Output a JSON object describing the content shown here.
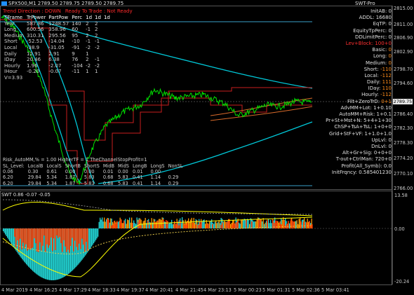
{
  "header": {
    "title": "SPX500,M1  2789.50 2789.75 2789.50 2789.75",
    "indicator": "SWT-Pro"
  },
  "status": {
    "trend_direction": "Trend Direction : DOWN",
    "ready": "Ready To Trade : Not Ready"
  },
  "stats_table": {
    "headers": [
      "TFrame",
      "TrPower",
      "PartPow",
      "Perc",
      "1d",
      "1d",
      "1d"
    ],
    "rows": [
      [
        "Year",
        "587.86",
        "1248.57",
        "140",
        "2",
        "2",
        ""
      ],
      [
        "Long",
        "600.56",
        "358.96",
        "60",
        "-1",
        "2",
        ""
      ],
      [
        "Medium",
        "310.31",
        "295.56",
        "95",
        "2",
        "2",
        ""
      ],
      [
        "Short",
        "-52.53",
        "-14.04",
        "-10",
        "-1",
        "-1",
        ""
      ],
      [
        "Local",
        "-38.9",
        "-31.05",
        "-91",
        "-2",
        "-2",
        ""
      ],
      [
        "Daily",
        "12.91",
        "2.91",
        "9",
        "1",
        "",
        ""
      ],
      [
        "IDay",
        "20.46",
        "6.38",
        "76",
        "2",
        "-1",
        ""
      ],
      [
        "Hourly",
        "1.96",
        "-2.07",
        "-104",
        "-2",
        "-2",
        ""
      ],
      [
        "IHour",
        "-0.20",
        "-0.07",
        "-11",
        "1",
        "1",
        ""
      ],
      [
        "V=3.93",
        "",
        "",
        "",
        "",
        "",
        ""
      ]
    ]
  },
  "risk": {
    "line1": "Risk_AutoMM,% = 1.00   HigherTF = 1     TheChannelStopProfit=1",
    "headers": [
      "SL_Level:",
      "LocalB",
      "LocalS",
      "ShortB",
      "ShortS",
      "MidB",
      "MidS",
      "LongB",
      "LongS",
      "NonSL"
    ],
    "rows": [
      [
        "0.06",
        "0.30",
        "0.61",
        "0.00",
        "0.00",
        "0.01",
        "0.00",
        "0.01",
        "0.00",
        ""
      ],
      [
        "6.20",
        "29.84",
        "5.34",
        "1.87",
        "5.83",
        "0.68",
        "5.83",
        "0.41",
        "1.14",
        "0.29"
      ],
      [
        "6.20",
        "29.84",
        "5.34",
        "1.87",
        "5.83",
        "0.68",
        "5.83",
        "0.41",
        "1.14",
        "0.29"
      ]
    ]
  },
  "panel": [
    {
      "label": "InitAB:",
      "value": "0",
      "c": "w"
    },
    {
      "label": "ADDL:",
      "value": "16680",
      "c": "w"
    },
    {
      "label": "EqTP:",
      "value": "0",
      "c": "w"
    },
    {
      "label": "EquityTpPerc:",
      "value": "0",
      "c": "w"
    },
    {
      "label": "DDLimitPerc:",
      "value": "0",
      "c": "w"
    },
    {
      "label": "Lev+Block:",
      "value": "100+0",
      "c": "r"
    },
    {
      "label": "Basic:",
      "value": "0",
      "c": "o"
    },
    {
      "label": "Long:",
      "value": "0",
      "c": "o"
    },
    {
      "label": "Medium:",
      "value": "0",
      "c": "o"
    },
    {
      "label": "Short:",
      "value": "-110",
      "c": "o"
    },
    {
      "label": "Local:",
      "value": "-112",
      "c": "o"
    },
    {
      "label": "Daily:",
      "value": "111",
      "c": "o"
    },
    {
      "label": "IDay:",
      "value": "110",
      "c": "o"
    },
    {
      "label": "Hourly:",
      "value": "-112",
      "c": "o"
    },
    {
      "label": "Filt+ZeroTrD:",
      "value": "0+1",
      "c": "o"
    },
    {
      "label": "AdvMM+Lot:",
      "value": "1+0.10",
      "c": "w"
    },
    {
      "label": "AutoMM+Risk:",
      "value": "1+0.1",
      "c": "w"
    },
    {
      "label": "Pr+St+Mst+N:",
      "value": "5+4+1+30",
      "c": "w"
    },
    {
      "label": "ChSP+TsA+TsL:",
      "value": "1+0+0",
      "c": "w"
    },
    {
      "label": "Grid+StF+VF:",
      "value": "1+1.0+1.0",
      "c": "w"
    },
    {
      "label": "UpLvl:",
      "value": "0",
      "c": "w"
    },
    {
      "label": "DnLvl:",
      "value": "0",
      "c": "w"
    },
    {
      "label": "Alt+Gr+Sig:",
      "value": "0+0+0",
      "c": "w"
    },
    {
      "label": "T-out+CtrlMan:",
      "value": "720+0",
      "c": "w"
    },
    {
      "label": "Profit(All_Symb):",
      "value": "0.0",
      "c": "w"
    },
    {
      "label": "InitFrqncy:",
      "value": "0.585401230",
      "c": "w"
    }
  ],
  "price_axis": [
    "2815.00",
    "2811.00",
    "2806.90",
    "2802.90",
    "2798.70",
    "2794.60",
    "2789.75",
    "2786.40",
    "2782.30",
    "2778.30",
    "2774.20",
    "2770.10",
    "2766.00"
  ],
  "price_tag": "2789.75",
  "sub": {
    "title": "SWT 0.86 -0.07 -0.05",
    "axis": [
      "13.58",
      "0.00",
      "-20.24"
    ]
  },
  "time_axis": [
    "4 Mar 2019",
    "4 Mar 16:25",
    "4 Mar 17:29",
    "4 Mar 18:33",
    "4 Mar 19:37",
    "4 Mar 20:41",
    "4 Mar 21:45",
    "4 Mar 23:13",
    "5 Mar 00:23",
    "5 Mar 01:31",
    "5 Mar 02:36",
    "5 Mar 03:41"
  ],
  "colors": {
    "candle": "#00e000",
    "channel": "#00c8d8",
    "level": "#c81e1e",
    "status": "#ff2a2a",
    "histo": "#22d3d3",
    "histo_red": "#ff3a00",
    "histo_orange": "#ff9a00",
    "yellow": "#ffff00"
  }
}
